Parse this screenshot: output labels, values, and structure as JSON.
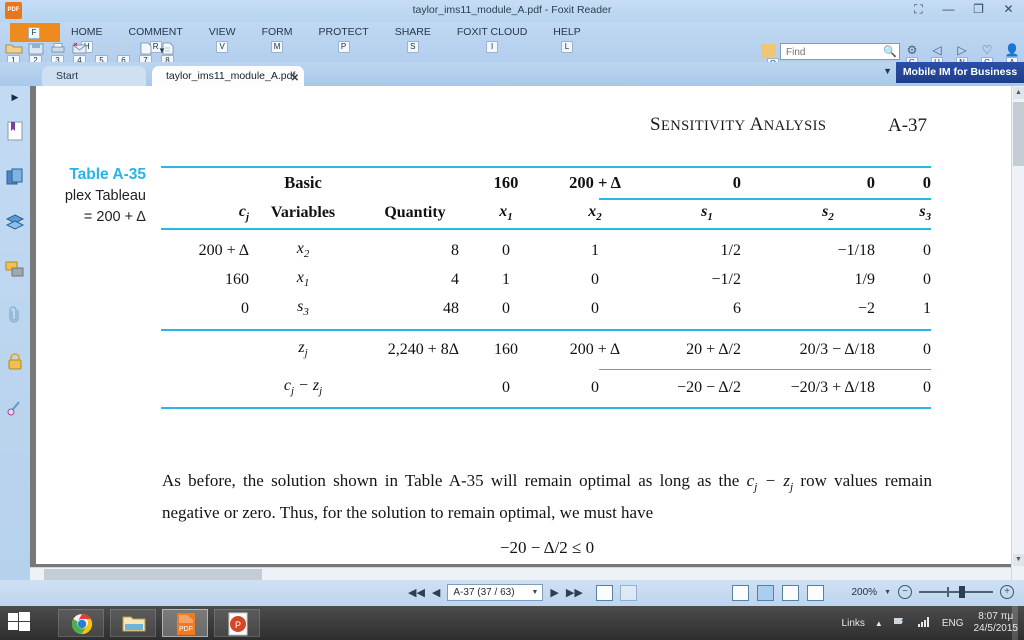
{
  "window": {
    "title": "taylor_ims11_module_A.pdf - Foxit Reader",
    "logo_text": "PDF",
    "buttons": {
      "ribbon_display": "⛶",
      "minimize": "—",
      "restore": "❐",
      "close": "✕"
    }
  },
  "ribbon": {
    "file_tab": {
      "label": "",
      "accelerator": "F"
    },
    "tabs": [
      {
        "label": "HOME",
        "accelerator": "H"
      },
      {
        "label": "COMMENT",
        "accelerator": "R"
      },
      {
        "label": "VIEW",
        "accelerator": "V"
      },
      {
        "label": "FORM",
        "accelerator": "M"
      },
      {
        "label": "PROTECT",
        "accelerator": "P"
      },
      {
        "label": "SHARE",
        "accelerator": "S"
      },
      {
        "label": "FOXIT CLOUD",
        "accelerator": "I"
      },
      {
        "label": "HELP",
        "accelerator": "L"
      }
    ],
    "quick_access": [
      {
        "icon": "open-folder-icon",
        "accelerator": "1"
      },
      {
        "icon": "save-icon",
        "accelerator": "2"
      },
      {
        "icon": "print-icon",
        "accelerator": "3"
      },
      {
        "icon": "email-icon",
        "accelerator": "4"
      },
      {
        "icon": "undo-icon",
        "accelerator": "5"
      },
      {
        "icon": "redo-icon",
        "accelerator": "6"
      },
      {
        "icon": "new-from-file-icon",
        "accelerator": "7"
      },
      {
        "icon": "create-pdf-icon",
        "accelerator": "8"
      }
    ],
    "search": {
      "placeholder": "Find",
      "value": "",
      "accelerator": "D",
      "target_accelerator": "Q"
    },
    "right_controls": [
      {
        "icon": "settings-gear-icon",
        "glyph": "⚙",
        "accelerator": "G"
      },
      {
        "icon": "previous-view-icon",
        "glyph": "◁",
        "accelerator": "U"
      },
      {
        "icon": "next-view-icon",
        "glyph": "▷",
        "accelerator": "N"
      },
      {
        "icon": "favorites-heart-icon",
        "glyph": "♡",
        "accelerator": "C"
      },
      {
        "icon": "user-account-icon",
        "glyph": "👤",
        "accelerator": "A"
      }
    ]
  },
  "tabs": {
    "items": [
      {
        "label": "Start",
        "active": false,
        "closable": false
      },
      {
        "label": "taylor_ims11_module_A.pdf",
        "active": true,
        "closable": true
      }
    ],
    "close_glyph": "✕"
  },
  "im_banner": {
    "label": "Mobile IM for Business"
  },
  "left_panel": {
    "expand_glyph": "▶",
    "items": [
      {
        "name": "bookmarks-icon"
      },
      {
        "name": "page-thumbnails-icon"
      },
      {
        "name": "layers-icon"
      },
      {
        "name": "comments-icon"
      },
      {
        "name": "attachments-icon"
      },
      {
        "name": "security-lock-icon"
      },
      {
        "name": "digital-signature-icon"
      }
    ]
  },
  "document": {
    "header": {
      "title": "SENSITIVITY ANALYSIS",
      "page_label": "A-37"
    },
    "caption": {
      "title": "Table A-35",
      "line1": "plex Tableau",
      "line2": "= 200 + Δ"
    },
    "table": {
      "cj_label": "cj",
      "headers": {
        "basic_variables": "Basic Variables",
        "basic_variables_l1": "Basic",
        "basic_variables_l2": "Variables",
        "quantity": "Quantity"
      },
      "objective_row": [
        "160",
        "200 + Δ",
        "0",
        "0",
        "0"
      ],
      "variable_columns": [
        "x1",
        "x2",
        "s1",
        "s2",
        "s3"
      ],
      "rows": [
        {
          "cj": "200 + Δ",
          "basic": "x2",
          "quantity": "8",
          "values": [
            "0",
            "1",
            "1/2",
            "−1/18",
            "0"
          ]
        },
        {
          "cj": "160",
          "basic": "x1",
          "quantity": "4",
          "values": [
            "1",
            "0",
            "−1/2",
            "1/9",
            "0"
          ]
        },
        {
          "cj": "0",
          "basic": "s3",
          "quantity": "48",
          "values": [
            "0",
            "0",
            "6",
            "−2",
            "1"
          ]
        }
      ],
      "zj_row": {
        "label": "zj",
        "quantity": "2,240 + 8Δ",
        "values": [
          "160",
          "200 + Δ",
          "20 + Δ/2",
          "20/3 − Δ/18",
          "0"
        ]
      },
      "cjzj_row": {
        "label": "cj − zj",
        "quantity": "",
        "values": [
          "0",
          "0",
          "−20 − Δ/2",
          "−20/3 + Δ/18",
          "0"
        ]
      }
    },
    "body": {
      "paragraph_part1": "As before, the solution shown in Table A-35 will remain optimal as long as the ",
      "paragraph_math": "cj − zj",
      "paragraph_part2": " row values remain negative or zero. Thus, for the solution to remain optimal, we must have",
      "equation": "−20 − Δ/2 ≤ 0"
    }
  },
  "statusbar": {
    "first_page_glyph": "◀◀",
    "prev_page_glyph": "◀",
    "page_value": "A-37 (37 / 63)",
    "next_page_glyph": "▶",
    "last_page_glyph": "▶▶",
    "view_modes": [
      "single-page-view",
      "continuous-view",
      "facing-view",
      "continuous-facing-view"
    ],
    "zoom_level": "200%",
    "zoom_out_glyph": "−",
    "zoom_in_glyph": "+"
  },
  "taskbar": {
    "start_label": "Start",
    "apps": [
      {
        "name": "chrome-taskbar-icon",
        "active": false
      },
      {
        "name": "file-explorer-taskbar-icon",
        "active": false
      },
      {
        "name": "foxit-reader-taskbar-icon",
        "active": true
      },
      {
        "name": "powerpoint-taskbar-icon",
        "active": false
      }
    ],
    "tray": {
      "links_label": "Links",
      "show_hidden_glyph": "▲",
      "language": "ENG",
      "time": "8:07 πμ",
      "date": "24/5/2015"
    }
  }
}
